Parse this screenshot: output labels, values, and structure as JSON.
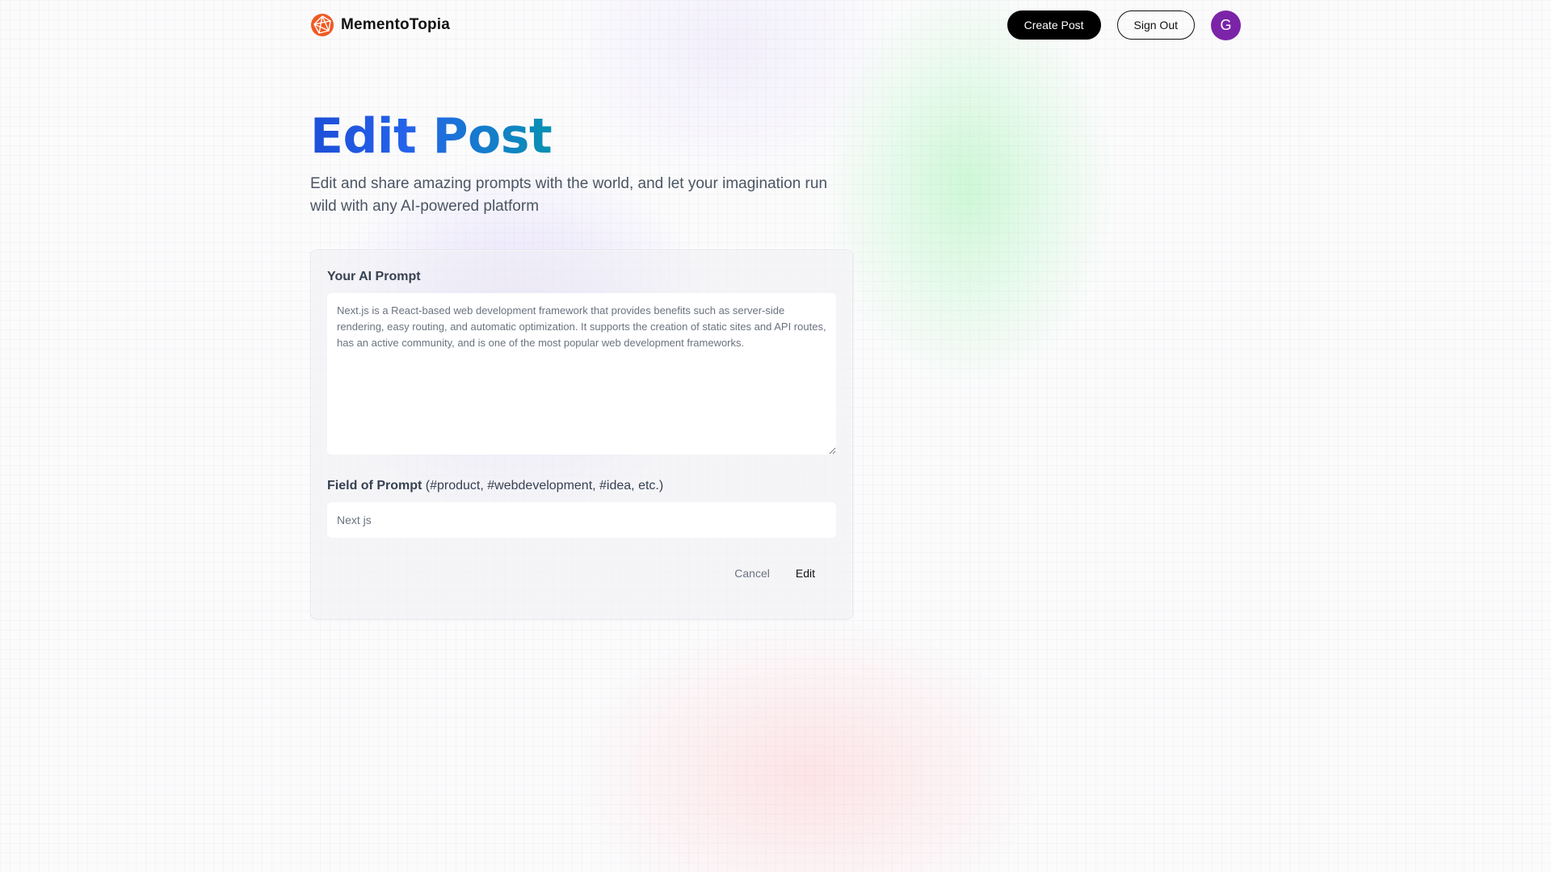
{
  "brand": {
    "name": "MementoTopia",
    "logo_icon": "globe-icon",
    "logo_color": "#f05a22"
  },
  "nav": {
    "create_post_label": "Create Post",
    "sign_out_label": "Sign Out",
    "avatar_initial": "G",
    "avatar_color": "#7b24a8"
  },
  "header": {
    "title": "Edit Post",
    "description": "Edit and share amazing prompts with the world, and let your imagination run wild with any AI-powered platform"
  },
  "form": {
    "prompt_label": "Your AI Prompt",
    "prompt_value": "Next.js is a React-based web development framework that provides benefits such as server-side rendering, easy routing, and automatic optimization. It supports the creation of static sites and API routes, has an active community, and is one of the most popular web development frameworks.",
    "tag_label": "Field of Prompt",
    "tag_hint": "(#product, #webdevelopment, #idea, etc.)",
    "tag_value": "Next js",
    "cancel_label": "Cancel",
    "edit_label": "Edit"
  },
  "colors": {
    "title_gradient_start": "#1d4ed8",
    "title_gradient_end": "#0891b2",
    "primary_button": "#000000"
  }
}
